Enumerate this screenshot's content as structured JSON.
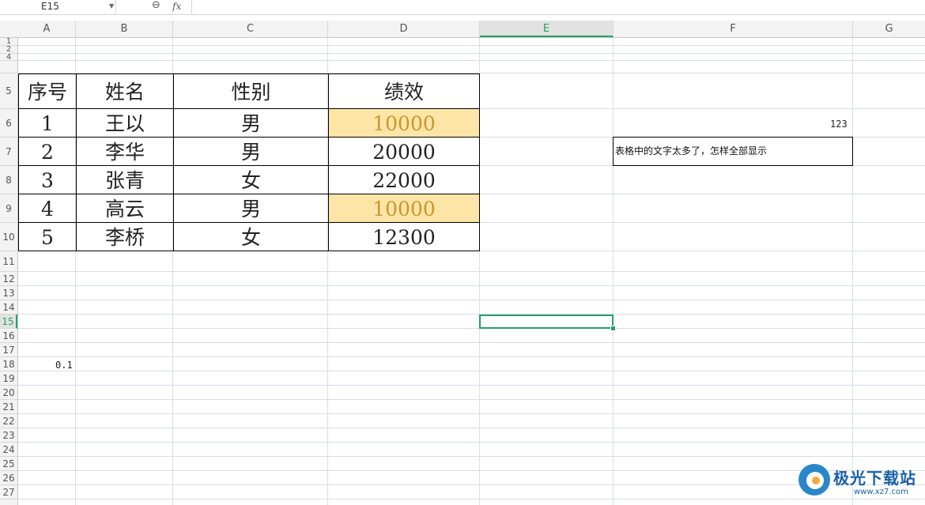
{
  "formula_bar": {
    "name_box": "E15",
    "fx_label": "fx",
    "formula_value": ""
  },
  "columns": [
    "A",
    "B",
    "C",
    "D",
    "E",
    "F",
    "G"
  ],
  "active_column": "E",
  "rows": [
    "1",
    "2",
    "4",
    "5",
    "6",
    "7",
    "8",
    "9",
    "10",
    "11",
    "12",
    "13",
    "14",
    "15",
    "16",
    "17",
    "18",
    "19",
    "20",
    "21",
    "22",
    "23",
    "24",
    "25",
    "26",
    "27"
  ],
  "active_row": "15",
  "table": {
    "header": [
      "序号",
      "姓名",
      "性别",
      "绩效"
    ],
    "rows": [
      [
        "1",
        "王以",
        "男",
        "10000"
      ],
      [
        "2",
        "李华",
        "男",
        "20000"
      ],
      [
        "3",
        "张青",
        "女",
        "22000"
      ],
      [
        "4",
        "高云",
        "男",
        "10000"
      ],
      [
        "5",
        "李桥",
        "女",
        "12300"
      ]
    ],
    "highlighted_rows": [
      0,
      3
    ],
    "highlight_color": "#fde5a8"
  },
  "cells": {
    "F6": "123",
    "F7": "表格中的文字太多了，怎样全部显示",
    "A18": "0.1"
  },
  "selection": {
    "cell": "E15",
    "color": "#21a366"
  },
  "watermark": {
    "name": "极光下载站",
    "url": "www.xz7.com"
  }
}
